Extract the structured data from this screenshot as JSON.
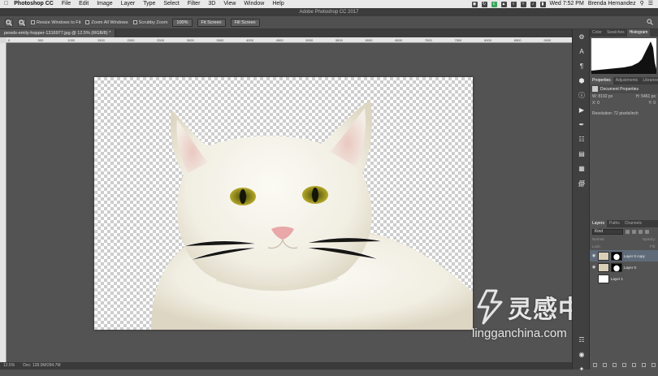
{
  "menubar": {
    "app_name": "Photoshop CC",
    "items": [
      "File",
      "Edit",
      "Image",
      "Layer",
      "Type",
      "Select",
      "Filter",
      "3D",
      "View",
      "Window",
      "Help"
    ],
    "clock": "Wed 7:52 PM",
    "user": "Brenda Hernandez"
  },
  "window_title": "Adobe Photoshop CC 2017",
  "options": {
    "resize_windows": "Resize Windows to Fit",
    "zoom_all": "Zoom All Windows",
    "scrubby_zoom": "Scrubby Zoom",
    "btn_100": "100%",
    "btn_fit": "Fit Screen",
    "btn_fill": "Fill Screen"
  },
  "document_tab": "pexels-emily-hopper-1316977.jpg @ 12.5% (RGB/8) *",
  "ruler_ticks": [
    "0",
    "500",
    "1000",
    "1500",
    "2000",
    "2500",
    "3000",
    "3500",
    "4000",
    "4500",
    "5000",
    "5500",
    "6000",
    "6500",
    "7000",
    "7500",
    "8000",
    "8500",
    "9000"
  ],
  "status": {
    "zoom": "12.5%",
    "doc": "Doc: 128.0M/284.7M"
  },
  "watermark": {
    "cn": "灵感中国",
    "url": "lingganchina.com"
  },
  "panels": {
    "top_tabs": [
      "Color",
      "Swatches",
      "Histogram"
    ],
    "mid_tabs": [
      "Properties",
      "Adjustments",
      "Libraries"
    ],
    "doc_props_title": "Document Properties",
    "w_label": "W: 8192 px",
    "h_label": "H: 5461 px",
    "x_label": "X: 0",
    "y_label": "Y: 0",
    "resolution": "Resolution: 72 pixels/inch",
    "layer_tabs": [
      "Layers",
      "Paths",
      "Channels"
    ],
    "kind": "Kind",
    "blend_mode": "Normal",
    "opacity": "Opacity:",
    "lock": "Lock:",
    "fill": "Fill:",
    "layers": [
      {
        "name": "Layer 0 copy",
        "selected": true
      },
      {
        "name": "Layer 0",
        "selected": false
      },
      {
        "name": "Layer 1",
        "selected": false
      }
    ]
  }
}
